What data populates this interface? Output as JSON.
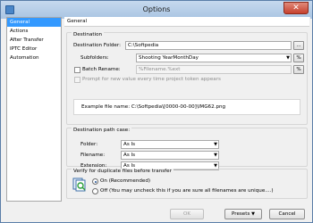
{
  "window": {
    "title": "Options"
  },
  "sidebar": {
    "items": [
      {
        "label": "General"
      },
      {
        "label": "Actions"
      },
      {
        "label": "After Transfer"
      },
      {
        "label": "IPTC Editor"
      },
      {
        "label": "Automation"
      }
    ]
  },
  "panel": {
    "title": "General"
  },
  "destination": {
    "group_label": "Destination",
    "folder_label": "Destination Folder:",
    "folder_value": "C:\\Softpedia",
    "browse_label": "...",
    "subfolders_label": "Subfolders:",
    "subfolders_value": "Shooting YearMonthDay",
    "percent_label": "%",
    "batch_rename_label": "Batch Rename:",
    "batch_rename_value": "%Filename.%ext",
    "prompt_label": "Prompt for new value every time project token appears",
    "example_text": "Example file name:  C:\\Softpedia\\[0000-00-00]\\IMG62.png"
  },
  "path_case": {
    "group_label": "Destination path case:",
    "folder_label": "Folder:",
    "folder_value": "As Is",
    "filename_label": "Filename:",
    "filename_value": "As Is",
    "extension_label": "Extension:",
    "extension_value": "As Is"
  },
  "verify": {
    "group_label": "Verify for duplicate files before transfer",
    "on_label": "On (Recommended)",
    "off_label": "Off (You may uncheck this if you are sure all filenames are unique....)"
  },
  "buttons": {
    "ok": "OK",
    "presets": "Presets",
    "cancel": "Cancel"
  }
}
